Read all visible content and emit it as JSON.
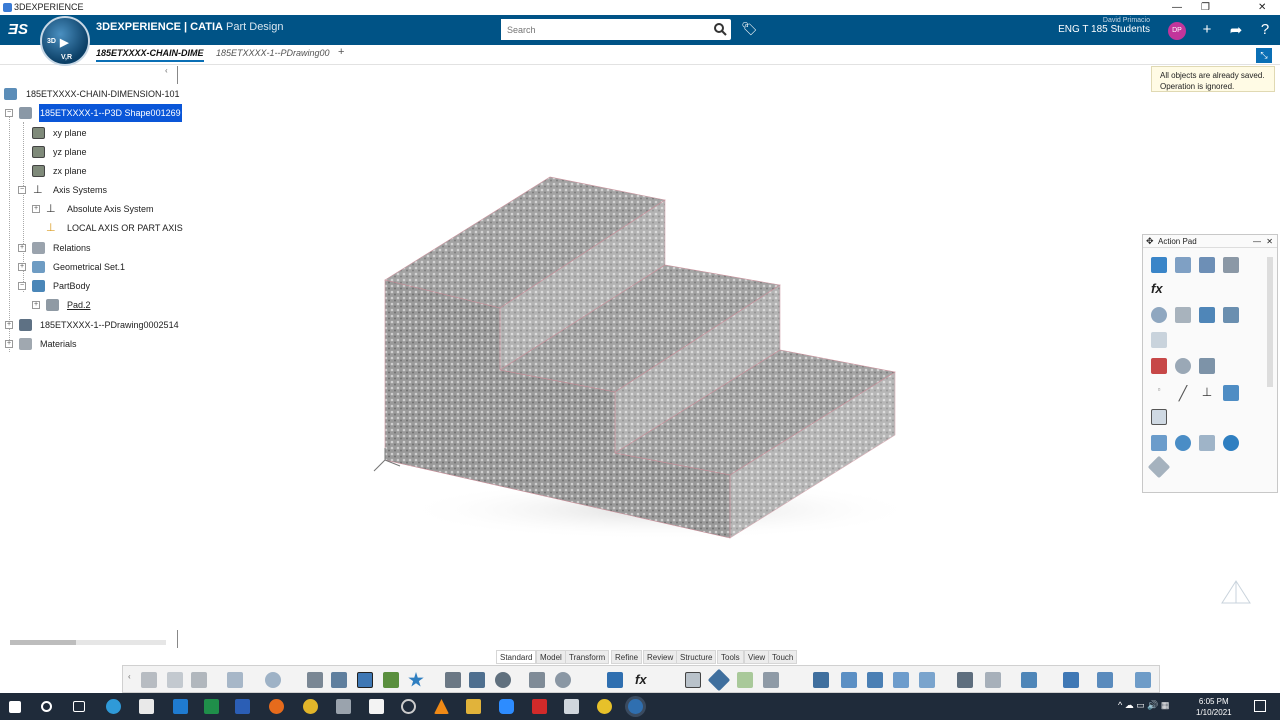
{
  "window": {
    "title": "3DEXPERIENCE"
  },
  "header": {
    "brand_bold": "3DEXPERIENCE | CATIA",
    "app_name": "Part Design",
    "search_placeholder": "Search",
    "user_name": "David Primacio",
    "team": "ENG T 185 Students",
    "avatar_initials": "DP",
    "compass_label_left": "3D",
    "compass_label_bottom": "V,R"
  },
  "tabs": [
    {
      "label": "185ETXXXX-CHAIN-DIME"
    },
    {
      "label": "185ETXXXX-1--PDrawing00"
    }
  ],
  "tree": {
    "root": "185ETXXXX-CHAIN-DIMENSION-101",
    "shape": "185ETXXXX-1--P3D Shape001269",
    "xy": "xy plane",
    "yz": "yz plane",
    "zx": "zx plane",
    "axis_systems": "Axis Systems",
    "absolute_axis": "Absolute Axis System",
    "local_axis": "LOCAL AXIS OR PART AXIS",
    "relations": "Relations",
    "geo_set": "Geometrical Set.1",
    "partbody": "PartBody",
    "pad": "Pad.2",
    "drawing": "185ETXXXX-1--PDrawing0002514",
    "materials": "Materials"
  },
  "notification": {
    "line1": "All objects are already saved.",
    "line2": "Operation is ignored."
  },
  "action_pad": {
    "title": "Action Pad",
    "fx": "fx"
  },
  "bottom_tabs": [
    "Standard",
    "Model",
    "Transform",
    "Refine",
    "Review",
    "Structure",
    "Tools",
    "View",
    "Touch"
  ],
  "active_bottom_tab": "Tools",
  "toolbar": {
    "fx": "fx"
  },
  "clock": {
    "time": "6:05 PM",
    "date": "1/10/2021"
  },
  "colors": {
    "topbar": "#005386",
    "accent": "#0a6fb5",
    "selection": "#0a56d8"
  }
}
